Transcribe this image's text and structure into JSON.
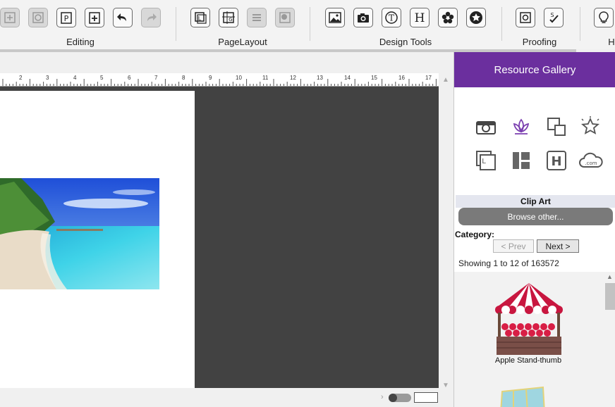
{
  "toolbar": {
    "groups": [
      {
        "label": "Editing"
      },
      {
        "label": "PageLayout"
      },
      {
        "label": "Design Tools"
      },
      {
        "label": "Proofing"
      },
      {
        "label": "H"
      }
    ],
    "buttons": [
      {
        "name": "insert-icon",
        "glyph": "+",
        "disabled": true
      },
      {
        "name": "copy-icon",
        "glyph": "C",
        "disabled": true
      },
      {
        "name": "paste-icon",
        "glyph": "P",
        "disabled": false
      },
      {
        "name": "add-page-icon",
        "glyph": "+",
        "disabled": false
      },
      {
        "name": "undo-icon",
        "glyph": "↶",
        "disabled": false
      },
      {
        "name": "redo-icon",
        "glyph": "↷",
        "disabled": true
      },
      {
        "name": "layout-icon",
        "glyph": "L",
        "disabled": false
      },
      {
        "name": "guides-icon",
        "glyph": "G",
        "disabled": false
      },
      {
        "name": "align-icon",
        "glyph": "≡",
        "disabled": true
      },
      {
        "name": "background-icon",
        "glyph": "◉",
        "disabled": true
      },
      {
        "name": "image-icon",
        "glyph": "▲",
        "disabled": false
      },
      {
        "name": "camera-icon",
        "glyph": "◙",
        "disabled": false
      },
      {
        "name": "text-icon",
        "glyph": "T",
        "disabled": false
      },
      {
        "name": "heading-icon",
        "glyph": "H",
        "disabled": false
      },
      {
        "name": "flower-icon",
        "glyph": "✿",
        "disabled": false
      },
      {
        "name": "star-badge-icon",
        "glyph": "★",
        "disabled": false
      },
      {
        "name": "proof-preview-icon",
        "glyph": "O",
        "disabled": false
      },
      {
        "name": "spellcheck-icon",
        "glyph": "S✓",
        "disabled": false
      },
      {
        "name": "help-bulb-icon",
        "glyph": "?",
        "disabled": false
      }
    ]
  },
  "ruler": {
    "numbers": [
      "2",
      "3",
      "4",
      "5",
      "6",
      "7",
      "8",
      "9",
      "10",
      "11",
      "12",
      "13",
      "14",
      "15",
      "16",
      "17"
    ]
  },
  "panel": {
    "title": "Resource Gallery",
    "gallery_icons": [
      "camera-icon",
      "lotus-icon",
      "shapes-icon",
      "star-outline-icon",
      "layout-frame-icon",
      "columns-icon",
      "heading-icon",
      "cloud-dotcom-icon"
    ],
    "cloud_text": ".com",
    "heading_glyph": "H",
    "section_title": "Clip Art",
    "browse_label": "Browse other...",
    "category_label": "Category:",
    "prev_label": "< Prev",
    "next_label": "Next >",
    "showing_text": "Showing 1 to 12 of 163572",
    "items": [
      {
        "label": "Apple Stand-thumb"
      }
    ]
  },
  "colors": {
    "panel_header": "#6b2f9e",
    "canvas_bg": "#424242",
    "browse_button": "#7a7a7a"
  }
}
